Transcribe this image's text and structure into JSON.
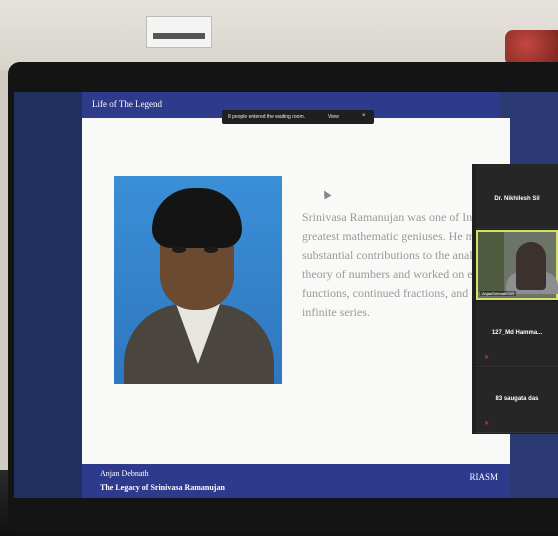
{
  "slide": {
    "title": "Life of The Legend",
    "body": "Srinivasa Ramanujan was one of India's greatest mathematic geniuses. He made substantial contributions to the analytical theory of numbers and worked on elliptic functions, continued fractions, and infinite series.",
    "footer_author": "Anjan Debnath",
    "footer_subtitle": "The Legacy of Srinivasa Ramanujan",
    "footer_org": "RIASM"
  },
  "notification": {
    "text": "8 people entered the waiting room.",
    "view_label": "View",
    "close_label": "×"
  },
  "participants": [
    {
      "name": "Dr. Nikhilesh Sil",
      "video": false
    },
    {
      "name": "AnjanDebnath333",
      "video": true
    },
    {
      "name": "127_Md Hamma...",
      "video": false,
      "muted": true
    },
    {
      "name": "83 saugata das",
      "video": false,
      "muted": true
    }
  ],
  "icons": {
    "muted_mic": "mic-off-icon"
  },
  "colors": {
    "slide_bar": "#2e3a8c",
    "active_speaker_border": "#d5e06a"
  }
}
